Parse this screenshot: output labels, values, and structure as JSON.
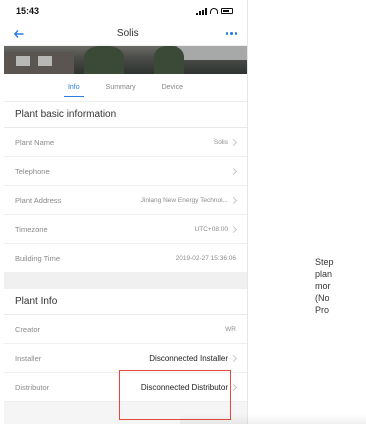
{
  "status": {
    "time": "15:43"
  },
  "nav": {
    "title": "Solis"
  },
  "tabs": [
    {
      "label": "Info",
      "active": true
    },
    {
      "label": "Summary",
      "active": false
    },
    {
      "label": "Device",
      "active": false
    }
  ],
  "basic": {
    "heading": "Plant basic information",
    "rows": [
      {
        "label": "Plant Name",
        "value": "Solis"
      },
      {
        "label": "Telephone",
        "value": ""
      },
      {
        "label": "Plant Address",
        "value": "Jinlang New Energy Technol..."
      },
      {
        "label": "Timezone",
        "value": "UTC+08:00"
      },
      {
        "label": "Building Time",
        "value": "2019-02-27 15:36:06"
      }
    ]
  },
  "plant_info": {
    "heading": "Plant Info",
    "rows": [
      {
        "label": "Creator",
        "value": "WR"
      },
      {
        "label": "Installer",
        "value": "Disconnected Installer"
      },
      {
        "label": "Distributor",
        "value": "Disconnected Distributor"
      }
    ]
  },
  "side_text": [
    "Step",
    "plan",
    "mor",
    "(No",
    "Pro"
  ],
  "colors": {
    "accent": "#2b7de1",
    "highlight": "#e14a3b"
  }
}
